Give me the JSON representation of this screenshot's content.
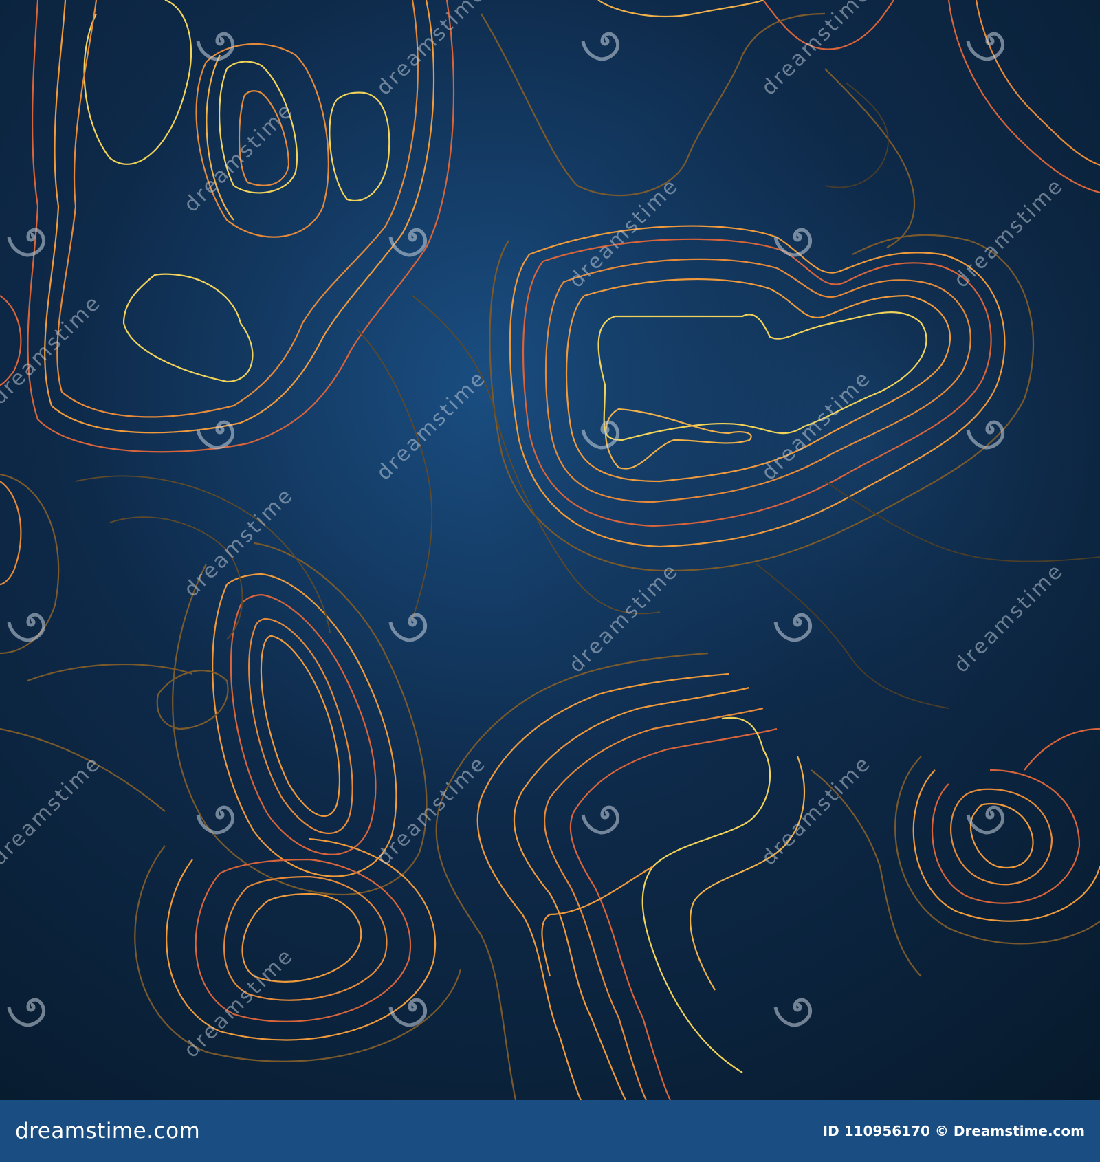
{
  "image": {
    "description_colors": {
      "background_deep": "#071a2c",
      "background_glow": "#1a4e82",
      "contour_yellow": "#f2d35a",
      "contour_orange": "#ef9a3c",
      "contour_red": "#d7643a",
      "contour_dim": "#7a5a2c",
      "watermark": "#c9d3de"
    },
    "watermark": {
      "icon": "spiral-icon",
      "text": "dreamstime"
    }
  },
  "footer": {
    "background": "#1a4e82",
    "logo_text": "dreamstime.com",
    "id_label": "ID",
    "id_value": "110956170",
    "copyright": "© Dreamstime.com",
    "text_color": "#ffffff"
  }
}
